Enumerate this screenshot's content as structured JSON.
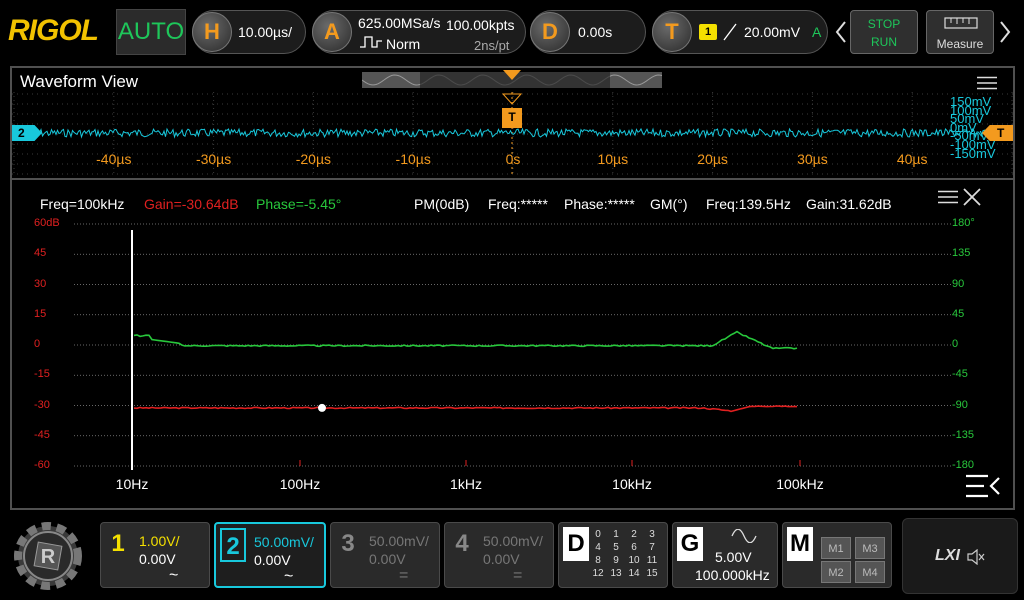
{
  "brand": "RIGOL",
  "mode": "AUTO",
  "horizontal": {
    "key": "H",
    "timebase": "10.00µs/"
  },
  "acquire": {
    "key": "A",
    "sample_rate": "625.00MSa/s",
    "memory": "100.00kpts",
    "type": "Norm",
    "resolution": "2ns/pt"
  },
  "delay": {
    "key": "D",
    "value": "0.00s"
  },
  "trigger": {
    "key": "T",
    "source": "1",
    "level": "20.00mV",
    "state": "A"
  },
  "run_control": {
    "stop": "STOP",
    "run": "RUN"
  },
  "measure_label": "Measure",
  "waveform_view": {
    "title": "Waveform View",
    "time_labels": [
      "-40µs",
      "-30µs",
      "-20µs",
      "-10µs",
      "0s",
      "10µs",
      "20µs",
      "30µs",
      "40µs"
    ],
    "volt_labels": [
      "150mV",
      "100mV",
      "50mV",
      "0mV",
      "-50mV",
      "-100mV",
      "-150mV"
    ],
    "channel_marker": "2",
    "trigger_marker": "T"
  },
  "bode": {
    "freq_info": "Freq=100kHz",
    "gain_info": "Gain=-30.64dB",
    "phase_info": "Phase=-5.45°",
    "pm_label": "PM(0dB)",
    "pm_freq": "Freq:*****",
    "pm_phase": "Phase:*****",
    "gm_label": "GM(°)",
    "gm_freq": "Freq:139.5Hz",
    "gm_gain": "Gain:31.62dB",
    "left_axis": [
      "60dB",
      "45",
      "30",
      "15",
      "0",
      "-15",
      "-30",
      "-45",
      "-60"
    ],
    "right_axis": [
      "180°",
      "135",
      "90",
      "45",
      "0",
      "-45",
      "-90",
      "-135",
      "-180"
    ],
    "x_axis": [
      "10Hz",
      "100Hz",
      "1kHz",
      "10kHz",
      "100kHz"
    ]
  },
  "channels": [
    {
      "num": "1",
      "scale": "1.00V/",
      "offset": "0.00V",
      "coupling": "~",
      "color": "#f4e000",
      "active": true
    },
    {
      "num": "2",
      "scale": "50.00mV/",
      "offset": "0.00V",
      "coupling": "~",
      "color": "#18c8dc",
      "active": true
    },
    {
      "num": "3",
      "scale": "50.00mV/",
      "offset": "0.00V",
      "coupling": "=",
      "color": "#777777",
      "active": false
    },
    {
      "num": "4",
      "scale": "50.00mV/",
      "offset": "0.00V",
      "coupling": "=",
      "color": "#777777",
      "active": false
    }
  ],
  "digital": {
    "key": "D",
    "numbers": [
      "0",
      "1",
      "2",
      "3",
      "4",
      "5",
      "6",
      "7",
      "8",
      "9",
      "10",
      "11",
      "12",
      "13",
      "14",
      "15"
    ]
  },
  "generator": {
    "key": "G",
    "amplitude": "5.00V",
    "frequency": "100.000kHz"
  },
  "math": {
    "key": "M",
    "buttons": [
      "M1",
      "M3",
      "M2",
      "M4"
    ]
  },
  "lxi": "LXI",
  "colors": {
    "gain": "#e02020",
    "phase": "#28c83c",
    "ch2": "#18c8dc",
    "trigger": "#f39a1e",
    "accent": "#f2c200"
  }
}
